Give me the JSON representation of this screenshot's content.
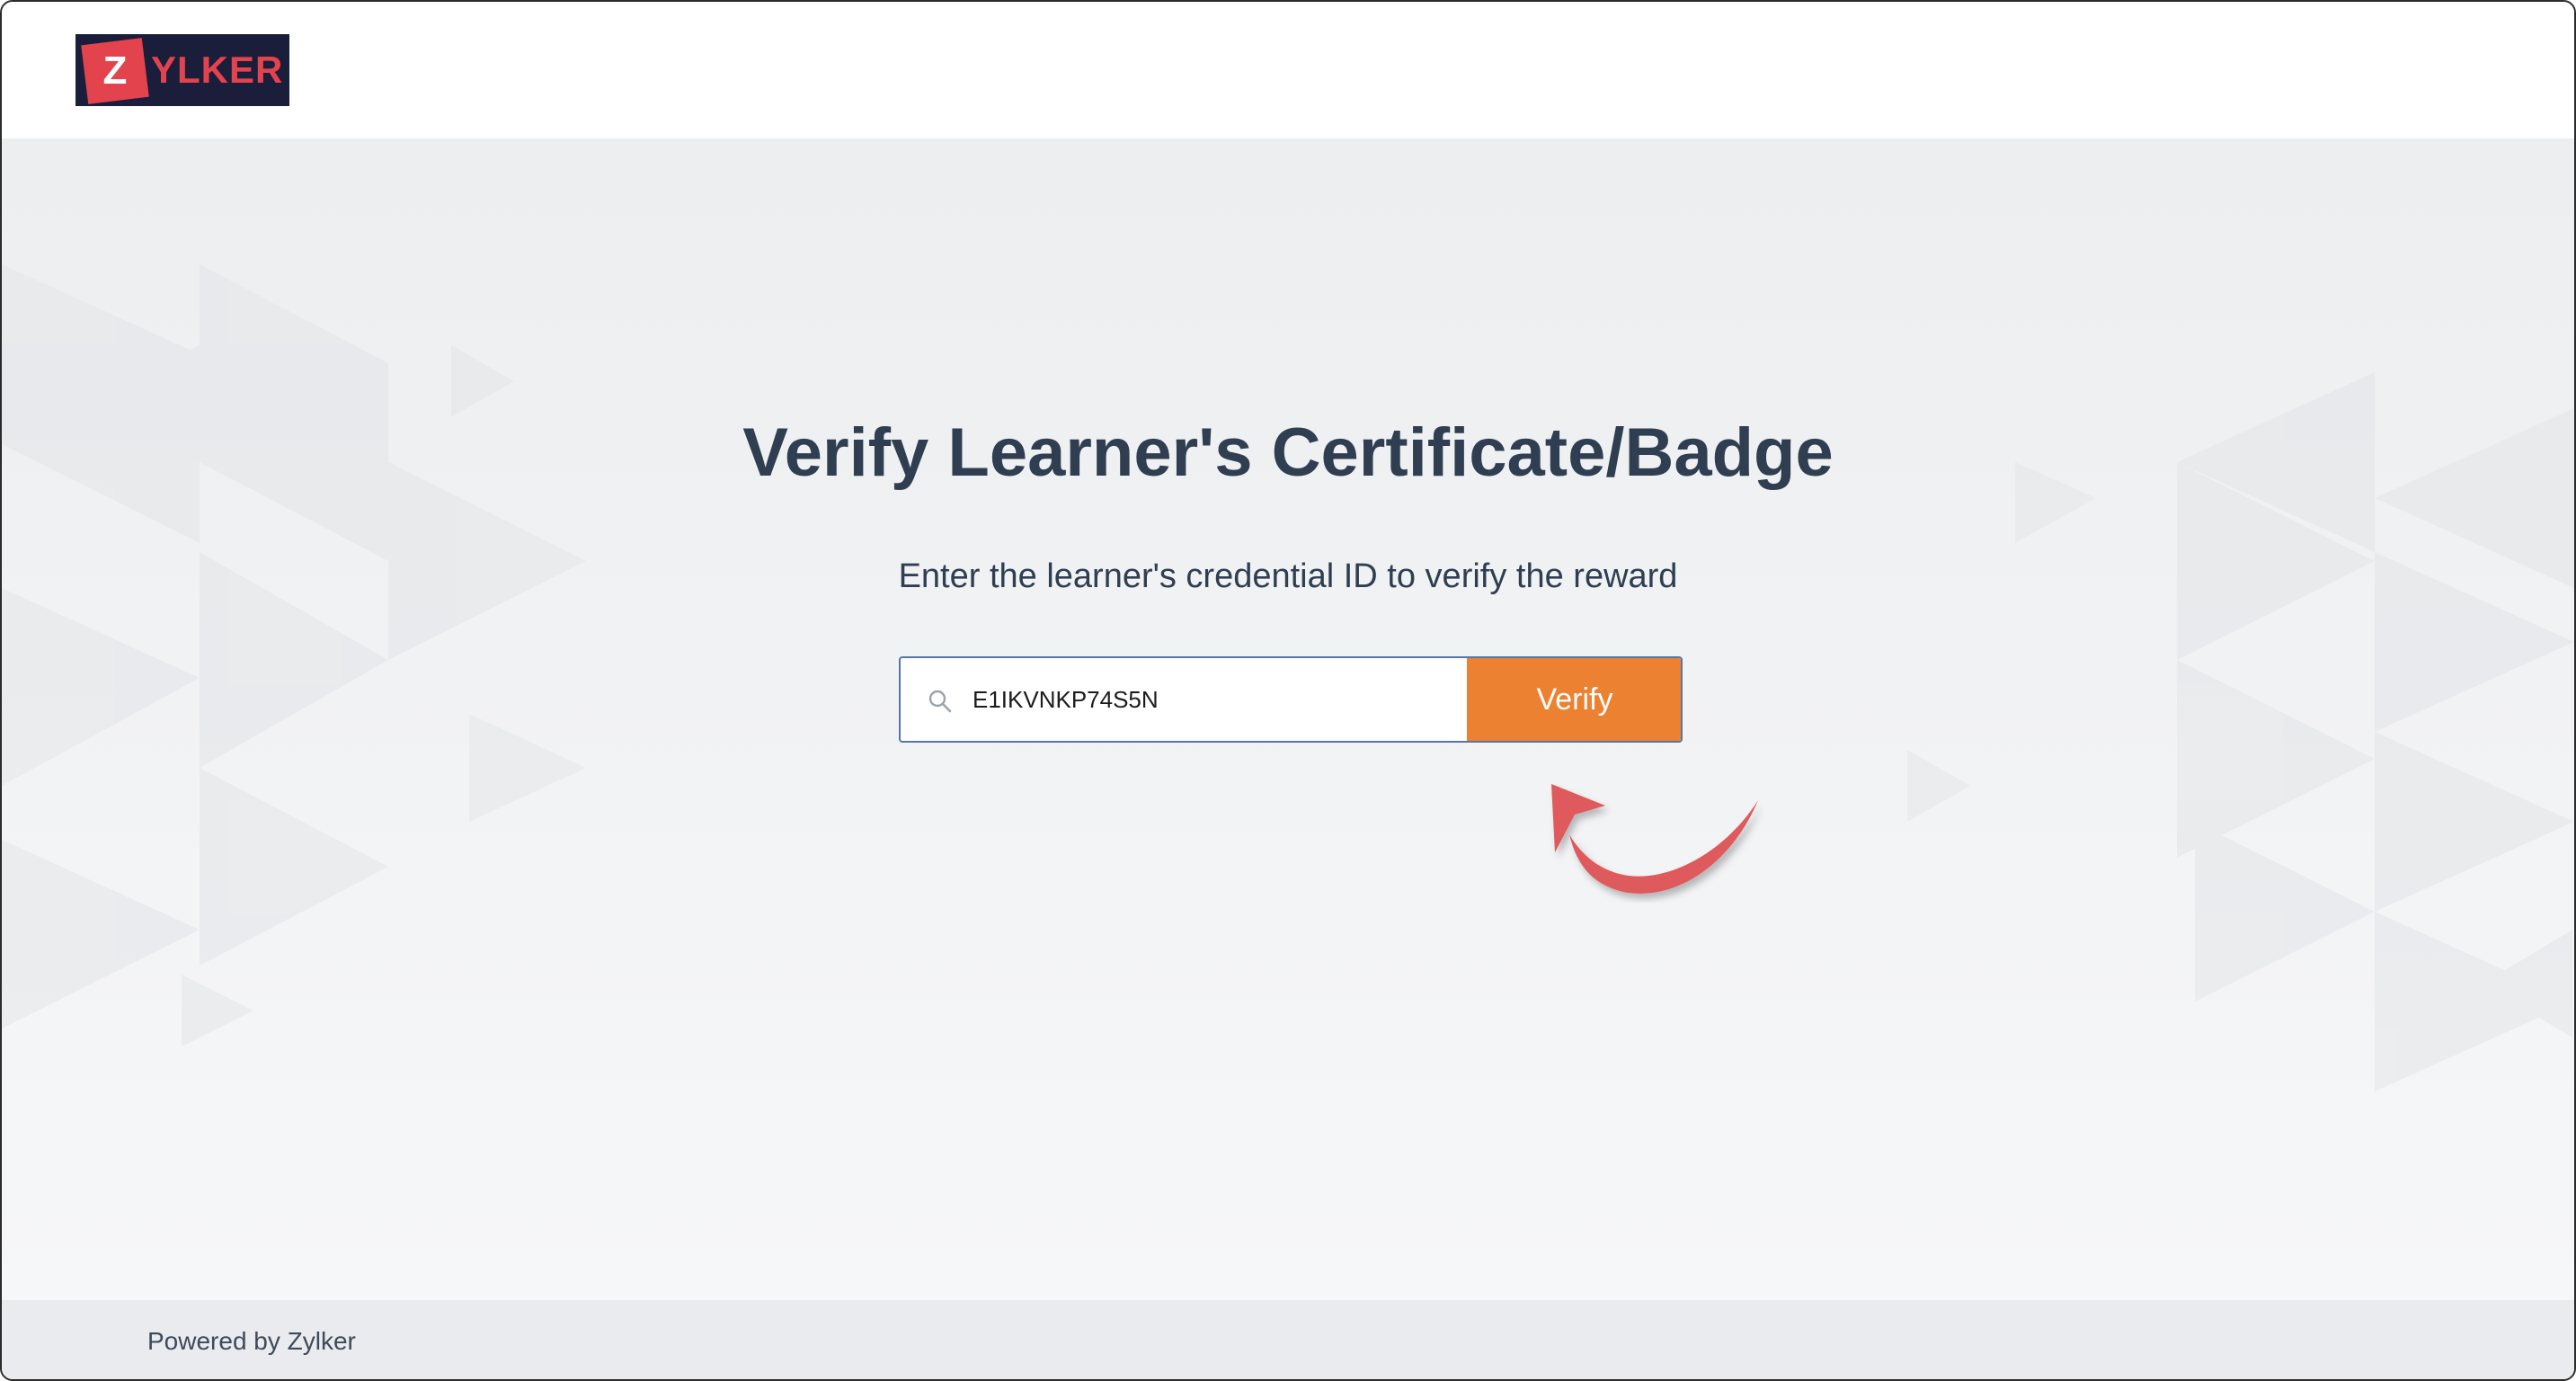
{
  "header": {
    "logo": {
      "letter": "Z",
      "text": "YLKER"
    }
  },
  "main": {
    "title": "Verify Learner's Certificate/Badge",
    "subtitle": "Enter the learner's credential ID to verify the reward",
    "search": {
      "value": "E1IKVNKP74S5N",
      "icon": "search-icon"
    },
    "verify_label": "Verify"
  },
  "footer": {
    "text": "Powered by Zylker"
  },
  "colors": {
    "brand_red": "#e2434d",
    "logo_bg": "#1a1e3b",
    "button_orange": "#ec8132",
    "heading": "#2f3e51",
    "input_border": "#5676a6"
  }
}
